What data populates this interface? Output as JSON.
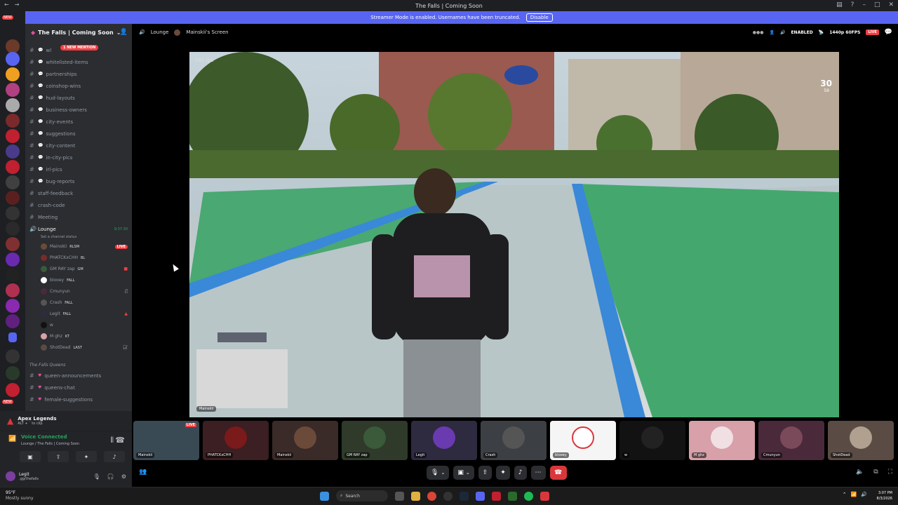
{
  "window": {
    "title": "The Falls | Coming Soon"
  },
  "banner": {
    "text": "Streamer Mode is enabled. Usernames have been truncated.",
    "disable_label": "Disable"
  },
  "rail": {
    "new_badge_top": "NEW",
    "new_badge_bottom": "NEW",
    "accent": "#5865f2"
  },
  "server": {
    "name": "The Falls | Coming Soon",
    "mention_pill": "1 NEW MENTION"
  },
  "channels": [
    {
      "name": "wl"
    },
    {
      "name": "whitelisted-items"
    },
    {
      "name": "partnerships"
    },
    {
      "name": "coinshop-wins"
    },
    {
      "name": "hud-layouts"
    },
    {
      "name": "business-owners"
    },
    {
      "name": "city-events"
    },
    {
      "name": "suggestions"
    },
    {
      "name": "city-content"
    },
    {
      "name": "in-city-pics"
    },
    {
      "name": "irl-pics"
    },
    {
      "name": "bug-reports"
    },
    {
      "name": "staff-feedback"
    },
    {
      "name": "crash-code"
    },
    {
      "name": "Meeting"
    }
  ],
  "voice_channel": {
    "name": "Lounge",
    "timer": "9:37:30",
    "status": "Set a channel status"
  },
  "voice_users": [
    {
      "name": "Mainskii",
      "tag": "RLSM",
      "live": "LIVE"
    },
    {
      "name": "PHATCKxCHH",
      "tag": "BL"
    },
    {
      "name": "GM RAY zap",
      "tag": "GM"
    },
    {
      "name": "blooey",
      "tag": "FALL"
    },
    {
      "name": "Cmunyun",
      "tag": ""
    },
    {
      "name": "Crash",
      "tag": "FALL"
    },
    {
      "name": "Legit",
      "tag": "FALL"
    },
    {
      "name": "w",
      "tag": ""
    },
    {
      "name": "M ghz",
      "tag": "KT"
    },
    {
      "name": "ShotDead",
      "tag": "LAST"
    }
  ],
  "category2": {
    "name": "The Falls Queens",
    "channels": [
      {
        "name": "queen-announcements"
      },
      {
        "name": "queens-chat"
      },
      {
        "name": "female-suggestions"
      }
    ]
  },
  "activity": {
    "game": "Apex Legends",
    "sub": "ALT + ` to clip"
  },
  "voice_panel": {
    "status": "Voice Connected",
    "location": "Lounge / The Falls | Coming Soon"
  },
  "user_panel": {
    "name": "Legit",
    "status": ".gg/thefalls"
  },
  "stage": {
    "channel": "Lounge",
    "screen_title": "Mainskii's Screen",
    "enabled_label": "ENABLED",
    "quality": "1440p 60FPS",
    "live": "LIVE",
    "fps_readout": "191 fps",
    "counter": "30",
    "counter_sub": "59",
    "screen_label": "Mainskii"
  },
  "tiles": [
    {
      "name": "Mainskii",
      "live": "LIVE",
      "color": "#3a4a55"
    },
    {
      "name": "PHATCKxCHH",
      "color": "#3b1f22"
    },
    {
      "name": "Mainskii",
      "color": "#3a2a28"
    },
    {
      "name": "GM RAY zap",
      "color": "#2f3a2a"
    },
    {
      "name": "Legit",
      "color": "#2e2a40"
    },
    {
      "name": "Crash",
      "color": "#3c3f44"
    },
    {
      "name": "blooey",
      "color": "#f5f5f5"
    },
    {
      "name": "w",
      "color": "#121212"
    },
    {
      "name": "M ghz",
      "color": "#d8a0a8"
    },
    {
      "name": "Cmunyun",
      "color": "#4a2a3a"
    },
    {
      "name": "ShotDead",
      "color": "#5a4c44"
    }
  ],
  "taskbar": {
    "temp": "95°F",
    "condition": "Mostly sunny",
    "search": "Search",
    "time": "3:07 PM",
    "date": "8/3/2026"
  }
}
